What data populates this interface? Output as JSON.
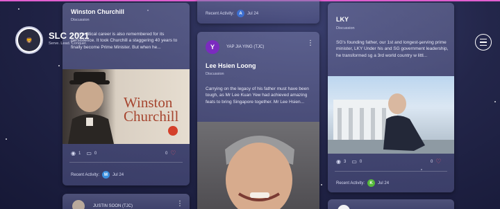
{
  "brand": {
    "title": "SLC 2021",
    "subtitle": "Serve. Lead. Conquer.",
    "logo_icon": "lion-logo-icon"
  },
  "menu": {
    "icon": "hamburger-menu-icon"
  },
  "colors": {
    "accent_top": "#e05fd0",
    "heart": "#e8546a",
    "avatar_m": "#3b8fe0",
    "avatar_k": "#55b93a",
    "avatar_y": "#7b2bbf",
    "avatar_a": "#3d6fd0"
  },
  "cards": {
    "churchill": {
      "title": "Winston Churchill",
      "category": "Discussion",
      "excerpt": "...ing political career is also remembered for its persistence. It took Churchill a staggering 40 years to finally become Prime Minister. But when he...",
      "image_caption_line1": "Winston",
      "image_caption_line2": "Churchill",
      "views": "1",
      "comments": "0",
      "likes": "0",
      "recent_label": "Recent Activity:",
      "recent_avatar": "M",
      "recent_date": "Jul 24"
    },
    "top_snippet": {
      "recent_label": "Recent Activity:",
      "recent_avatar": "A",
      "recent_date": "Jul 24"
    },
    "lhl": {
      "author_avatar": "Y",
      "author": "YAP JIA YING (TJC)",
      "title": "Lee Hsien Loong",
      "category": "Discussion",
      "excerpt": "Carrying on the legacy of his father must have been tough, as Mr Lee Kuan Yew had achieved amazing feats to bring Singapore together. Mr Lee Hsien..."
    },
    "lky": {
      "title": "LKY",
      "category": "Discussion",
      "excerpt": "SG's founding father, our 1st and longest-serving prime minister, LKY Under his and SG government leadership, he transformed sg a 3rd world country w littl...",
      "views": "3",
      "comments": "0",
      "likes": "0",
      "recent_label": "Recent Activity:",
      "recent_avatar": "K",
      "recent_date": "Jul 24"
    },
    "bottom_left": {
      "author": "JUSTIN SOON (TJC)"
    }
  }
}
